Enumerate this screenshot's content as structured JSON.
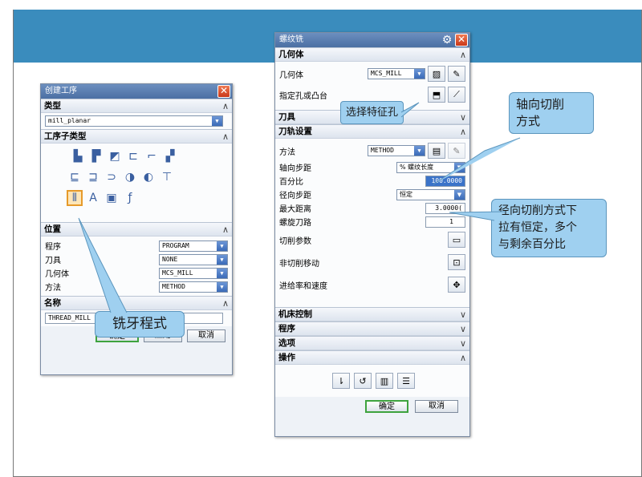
{
  "create_op": {
    "title": "创建工序",
    "type_head": "类型",
    "type_value": "mill_planar",
    "subtype_head": "工序子类型",
    "subtype_icons": [
      "pocket-icon",
      "face-icon",
      "profile-icon",
      "slot-icon",
      "wall-icon",
      "floor-icon",
      "clean-icon",
      "chamfer-icon",
      "contour-icon",
      "rough-icon",
      "finish-icon",
      "drill-icon",
      "thread-mill-icon",
      "text-icon",
      "probe-icon",
      "tool-change-icon"
    ],
    "pos_head": "位置",
    "rows": [
      {
        "label": "程序",
        "value": "PROGRAM"
      },
      {
        "label": "刀具",
        "value": "NONE"
      },
      {
        "label": "几何体",
        "value": "MCS_MILL"
      },
      {
        "label": "方法",
        "value": "METHOD"
      }
    ],
    "name_head": "名称",
    "name_value": "THREAD_MILL",
    "ok": "确定",
    "apply": "应用",
    "cancel": "取消"
  },
  "thread_mill": {
    "title": "螺纹铣",
    "geom_head": "几何体",
    "geom_label": "几何体",
    "geom_value": "MCS_MILL",
    "hole_label": "指定孔或凸台",
    "tool_head": "刀具",
    "path_head": "刀轨设置",
    "method_label": "方法",
    "method_value": "METHOD",
    "axial_label": "轴向步距",
    "axial_value": "% 螺纹长度",
    "percent_label": "百分比",
    "percent_value": "100.0000",
    "radial_label": "径向步距",
    "radial_value": "恒定",
    "maxdist_label": "最大距离",
    "maxdist_value": "3.0000(",
    "helix_label": "螺旋刀路",
    "helix_value": "1",
    "cut_params": "切削参数",
    "noncut": "非切削移动",
    "feeds": "进给率和速度",
    "machine_head": "机床控制",
    "program_head": "程序",
    "options_head": "选项",
    "actions_head": "操作",
    "ok": "确定",
    "cancel": "取消"
  },
  "callouts": {
    "select_hole": "选择特征孔",
    "axial": "轴向切削\n方式",
    "radial": "径向切削方式下\n拉有恒定，多个\n与剩余百分比",
    "thread_prog": "铣牙程式"
  },
  "colors": {
    "band": "#3a8cbd",
    "callout": "#9fd0f0",
    "titlebar": "#4b6fa3"
  }
}
